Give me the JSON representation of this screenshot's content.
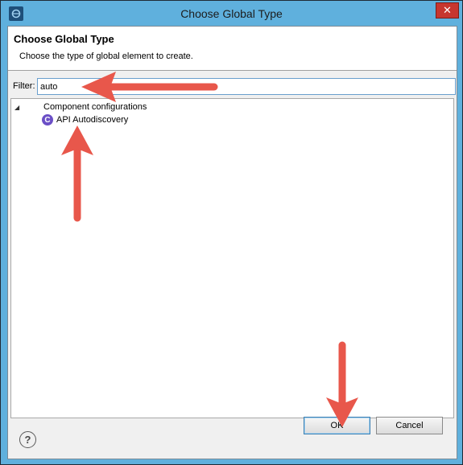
{
  "window": {
    "title": "Choose Global Type",
    "app_icon": "eclipse-app-icon",
    "close_label": "✕"
  },
  "header": {
    "title": "Choose Global Type",
    "description": "Choose the type of global element to create."
  },
  "filter": {
    "label": "Filter:",
    "value": "auto"
  },
  "tree": {
    "category": {
      "label": "Component configurations",
      "expanded": true
    },
    "items": [
      {
        "label": "API Autodiscovery",
        "icon": "connector-c-icon"
      }
    ]
  },
  "footer": {
    "help_label": "?",
    "ok_label": "OK",
    "cancel_label": "Cancel"
  },
  "annotation_color": "#e8574b"
}
